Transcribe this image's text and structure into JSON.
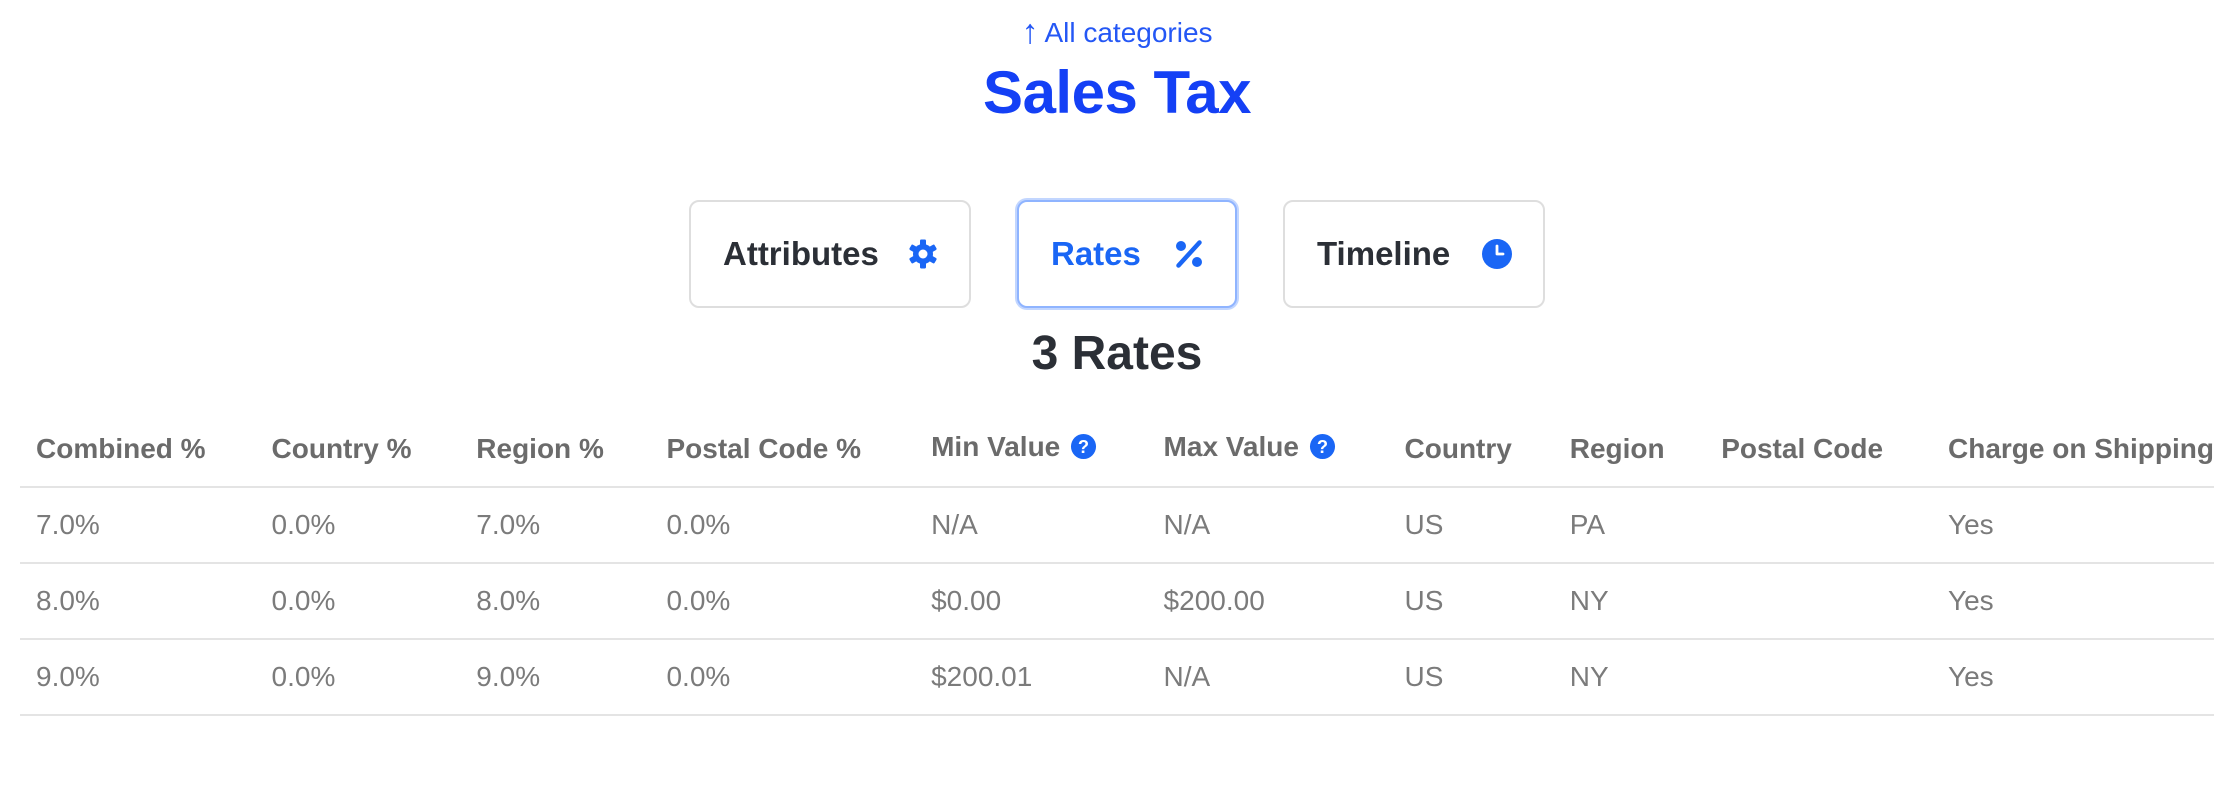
{
  "nav": {
    "back_arrow": "↑",
    "back_label": "All categories"
  },
  "page": {
    "title": "Sales Tax"
  },
  "tabs": [
    {
      "label": "Attributes",
      "icon": "gear-icon",
      "active": false
    },
    {
      "label": "Rates",
      "icon": "percent-icon",
      "active": true
    },
    {
      "label": "Timeline",
      "icon": "clock-icon",
      "active": false
    }
  ],
  "section": {
    "title": "3 Rates"
  },
  "table": {
    "columns": [
      "Combined %",
      "Country %",
      "Region %",
      "Postal Code %",
      "Min Value",
      "Max Value",
      "Country",
      "Region",
      "Postal Code",
      "Charge on Shipping"
    ],
    "rows": [
      [
        "7.0%",
        "0.0%",
        "7.0%",
        "0.0%",
        "N/A",
        "N/A",
        "US",
        "PA",
        "",
        "Yes"
      ],
      [
        "8.0%",
        "0.0%",
        "8.0%",
        "0.0%",
        "$0.00",
        "$200.00",
        "US",
        "NY",
        "",
        "Yes"
      ],
      [
        "9.0%",
        "0.0%",
        "9.0%",
        "0.0%",
        "$200.01",
        "N/A",
        "US",
        "NY",
        "",
        "Yes"
      ]
    ]
  },
  "colors": {
    "accent": "#1a66f5",
    "title": "#1440f5",
    "link": "#2457f5"
  }
}
